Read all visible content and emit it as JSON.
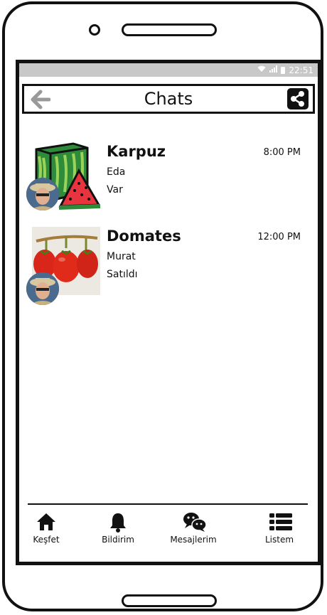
{
  "status_bar": {
    "time": "22:51"
  },
  "header": {
    "title": "Chats"
  },
  "chats": [
    {
      "name": "Karpuz",
      "sender": "Eda",
      "message": "Var",
      "time": "8:00 PM"
    },
    {
      "name": "Domates",
      "sender": "Murat",
      "message": "Satıldı",
      "time": "12:00 PM"
    }
  ],
  "nav": {
    "items": [
      {
        "label": "Keşfet",
        "icon": "home-icon"
      },
      {
        "label": "Bildirim",
        "icon": "bell-icon"
      },
      {
        "label": "Mesajlerim",
        "icon": "chat-bubbles-icon"
      },
      {
        "label": "Listem",
        "icon": "list-icon"
      }
    ]
  }
}
